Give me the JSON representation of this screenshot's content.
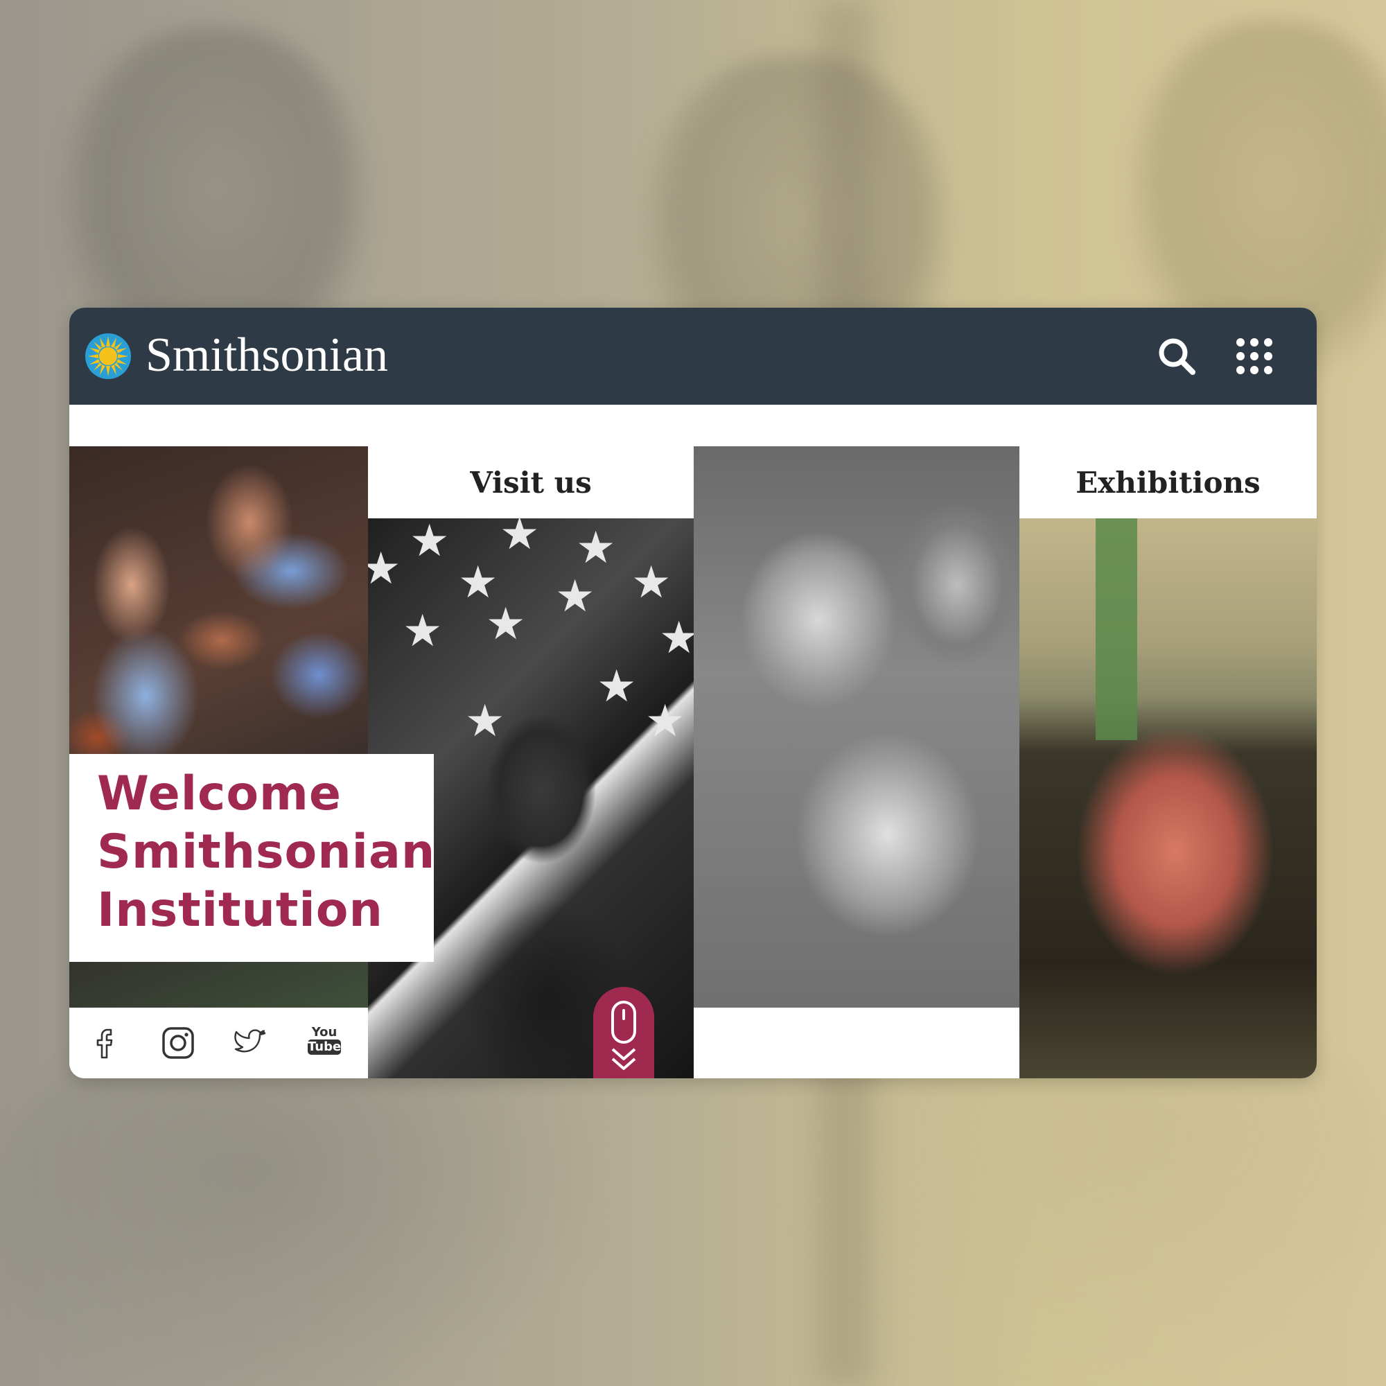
{
  "site": {
    "brand": "Smithsonian",
    "colors": {
      "header_bg": "#2e3a45",
      "accent": "#a0294f",
      "logo_sun": "#f4c21a",
      "logo_ring": "#2a9fd6"
    }
  },
  "header": {
    "logo_icon": "sun-logo-icon",
    "actions": [
      {
        "name": "search",
        "icon": "search-icon"
      },
      {
        "name": "menu",
        "icon": "grid-menu-icon"
      }
    ]
  },
  "hero": {
    "welcome_lines": [
      "Welcome",
      "Smithsonian",
      "Institution"
    ]
  },
  "social": [
    {
      "name": "facebook",
      "icon": "facebook-icon"
    },
    {
      "name": "instagram",
      "icon": "instagram-icon"
    },
    {
      "name": "twitter",
      "icon": "twitter-icon"
    },
    {
      "name": "youtube",
      "icon": "youtube-icon",
      "text_top": "You",
      "text_bottom": "Tube"
    }
  ],
  "panels": [
    {
      "title": "Visit us"
    },
    {
      "title": "Exhibitions"
    }
  ],
  "scroll_indicator": {
    "icon": "scroll-down-icon"
  }
}
